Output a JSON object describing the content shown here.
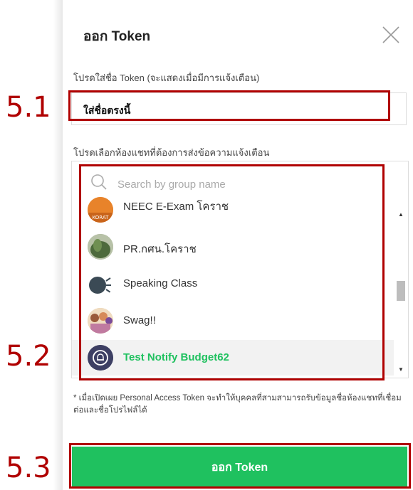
{
  "dialog": {
    "title": "ออก Token",
    "close_icon": "close-icon"
  },
  "token_name": {
    "label": "โปรดใส่ชื่อ Token (จะแสดงเมื่อมีการแจ้งเตือน)",
    "value": "ใส่ชื่อตรงนี้"
  },
  "chat_select": {
    "label": "โปรดเลือกห้องแชทที่ต้องการส่งข้อความแจ้งเตือน",
    "search_placeholder": "Search by group name",
    "items": [
      {
        "name": "NEEC E-Exam โคราช",
        "avatar_text": "KORAT"
      },
      {
        "name": "PR.กศน.โคราช"
      },
      {
        "name": "Speaking Class"
      },
      {
        "name": "Swag!!"
      },
      {
        "name": "Test Notify Budget62",
        "selected": true
      }
    ]
  },
  "note": "* เมื่อเปิดเผย Personal Access Token จะทำให้บุคคลที่สามสามารถรับข้อมูลชื่อห้องแชทที่เชื่อมต่อและชื่อโปรไฟล์ได้",
  "submit_label": "ออก Token",
  "callouts": {
    "step1": "5.1",
    "step2": "5.2",
    "step3": "5.3"
  },
  "colors": {
    "accent_green": "#1fc15f",
    "callout_red": "#b00000"
  }
}
